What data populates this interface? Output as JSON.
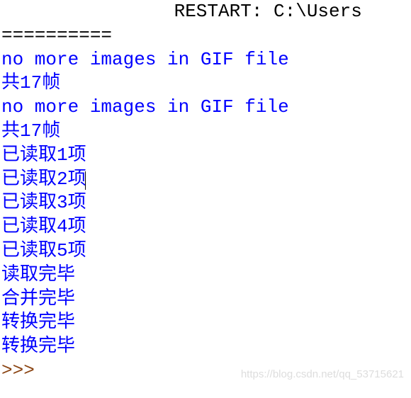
{
  "header": {
    "restart": " RESTART: C:\\Users",
    "separator": "=========="
  },
  "output": {
    "lines": [
      "no more images in GIF file",
      "共17帧",
      "no more images in GIF file",
      "共17帧",
      "已读取1项",
      "已读取2项",
      "已读取3项",
      "已读取4项",
      "已读取5项",
      "读取完毕",
      "合并完毕",
      "转换完毕",
      "转换完毕"
    ]
  },
  "prompt": ">>> ",
  "watermark": "https://blog.csdn.net/qq_53715621"
}
